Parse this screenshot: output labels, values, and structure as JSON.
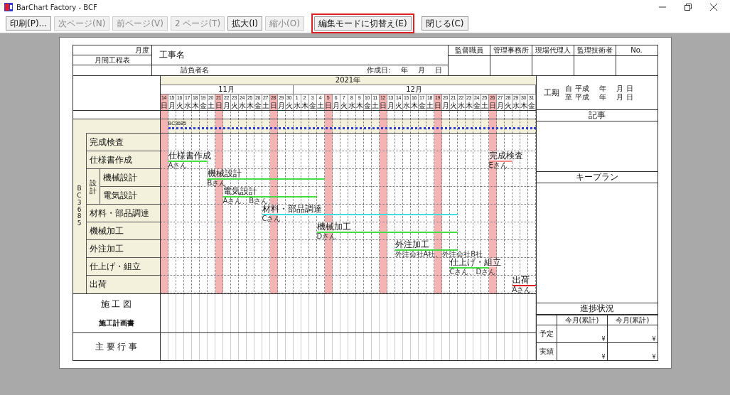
{
  "window": {
    "title": "BarChart Factory - BCF"
  },
  "toolbar": [
    {
      "label": "印刷(P)...",
      "disabled": false,
      "highlighted": false
    },
    {
      "label": "次ページ(N)",
      "disabled": true,
      "highlighted": false
    },
    {
      "label": "前ページ(V)",
      "disabled": true,
      "highlighted": false
    },
    {
      "label": "2 ページ(T)",
      "disabled": true,
      "highlighted": false
    },
    {
      "label": "拡大(I)",
      "disabled": false,
      "highlighted": false
    },
    {
      "label": "縮小(O)",
      "disabled": true,
      "highlighted": false
    },
    {
      "label": "編集モードに切替え(E)",
      "disabled": false,
      "highlighted": true
    },
    {
      "label": "閉じる(C)",
      "disabled": false,
      "highlighted": false
    }
  ],
  "header": {
    "month_label": "月度",
    "sheet_title": "月間工程表",
    "project_name_label": "工事名",
    "contractor_label": "請負者名",
    "created_label": "作成日:",
    "created_year": "年",
    "created_month": "月",
    "created_day": "日",
    "approvals": [
      "監督職員",
      "管理事務所",
      "現場代理人",
      "監理技術者",
      "No."
    ]
  },
  "schedule": {
    "calendar": {
      "year": "2021年",
      "months": [
        {
          "label": "11月",
          "days": [
            {
              "day": "14",
              "weekday": "日",
              "holiday": true
            },
            {
              "day": "15",
              "weekday": "月",
              "holiday": false
            },
            {
              "day": "16",
              "weekday": "火",
              "holiday": false
            },
            {
              "day": "17",
              "weekday": "水",
              "holiday": false
            },
            {
              "day": "18",
              "weekday": "木",
              "holiday": false
            },
            {
              "day": "19",
              "weekday": "金",
              "holiday": false
            },
            {
              "day": "20",
              "weekday": "土",
              "holiday": false
            },
            {
              "day": "21",
              "weekday": "日",
              "holiday": true
            },
            {
              "day": "22",
              "weekday": "月",
              "holiday": false
            },
            {
              "day": "23",
              "weekday": "火",
              "holiday": false
            },
            {
              "day": "24",
              "weekday": "水",
              "holiday": false
            },
            {
              "day": "25",
              "weekday": "木",
              "holiday": false
            },
            {
              "day": "26",
              "weekday": "金",
              "holiday": false
            },
            {
              "day": "27",
              "weekday": "土",
              "holiday": false
            },
            {
              "day": "28",
              "weekday": "日",
              "holiday": true
            },
            {
              "day": "29",
              "weekday": "月",
              "holiday": false
            },
            {
              "day": "30",
              "weekday": "火",
              "holiday": false
            }
          ]
        },
        {
          "label": "12月",
          "days": [
            {
              "day": "1",
              "weekday": "水",
              "holiday": false
            },
            {
              "day": "2",
              "weekday": "木",
              "holiday": false
            },
            {
              "day": "3",
              "weekday": "金",
              "holiday": false
            },
            {
              "day": "4",
              "weekday": "土",
              "holiday": false
            },
            {
              "day": "5",
              "weekday": "日",
              "holiday": true
            },
            {
              "day": "6",
              "weekday": "月",
              "holiday": false
            },
            {
              "day": "7",
              "weekday": "火",
              "holiday": false
            },
            {
              "day": "8",
              "weekday": "水",
              "holiday": false
            },
            {
              "day": "9",
              "weekday": "木",
              "holiday": false
            },
            {
              "day": "10",
              "weekday": "金",
              "holiday": false
            },
            {
              "day": "11",
              "weekday": "土",
              "holiday": false
            },
            {
              "day": "12",
              "weekday": "日",
              "holiday": true
            },
            {
              "day": "13",
              "weekday": "月",
              "holiday": false
            },
            {
              "day": "14",
              "weekday": "火",
              "holiday": false
            },
            {
              "day": "15",
              "weekday": "水",
              "holiday": false
            },
            {
              "day": "16",
              "weekday": "木",
              "holiday": false
            },
            {
              "day": "17",
              "weekday": "金",
              "holiday": false
            },
            {
              "day": "18",
              "weekday": "土",
              "holiday": false
            },
            {
              "day": "19",
              "weekday": "日",
              "holiday": true
            },
            {
              "day": "20",
              "weekday": "月",
              "holiday": false
            },
            {
              "day": "21",
              "weekday": "火",
              "holiday": false
            },
            {
              "day": "22",
              "weekday": "水",
              "holiday": false
            },
            {
              "day": "23",
              "weekday": "木",
              "holiday": false
            },
            {
              "day": "24",
              "weekday": "金",
              "holiday": false
            },
            {
              "day": "25",
              "weekday": "土",
              "holiday": false
            },
            {
              "day": "26",
              "weekday": "日",
              "holiday": true
            },
            {
              "day": "27",
              "weekday": "月",
              "holiday": false
            },
            {
              "day": "28",
              "weekday": "火",
              "holiday": false
            },
            {
              "day": "29",
              "weekday": "水",
              "holiday": false
            },
            {
              "day": "30",
              "weekday": "木",
              "holiday": false
            },
            {
              "day": "31",
              "weekday": "金",
              "holiday": false
            }
          ]
        }
      ]
    },
    "project_code": "BC3685",
    "project": {
      "label": "BC3685",
      "color": "#2b3bd8"
    },
    "tasks": [
      {
        "label": "完成検査"
      },
      {
        "label": "仕様書作成",
        "bars": [
          {
            "label": "仕様書作成",
            "assignee": "Aさん",
            "color": "#44dd44"
          },
          {
            "label": "完成検査",
            "assignee": "Eさん",
            "color": "#f08c8c"
          }
        ]
      },
      {
        "label": "設計",
        "children": [
          {
            "label": "機械設計",
            "bars": [
              {
                "label": "機械設計",
                "assignee": "Bさん",
                "color": "#44dd44"
              }
            ]
          },
          {
            "label": "電気設計",
            "bars": [
              {
                "label": "電気設計",
                "assignee": "Aさん、Bさん",
                "color": "#44dd44"
              }
            ]
          }
        ]
      },
      {
        "label": "材料・部品調達",
        "bars": [
          {
            "label": "材料・部品調達",
            "assignee": "Cさん",
            "color": "#44dddd"
          }
        ]
      },
      {
        "label": "機械加工",
        "bars": [
          {
            "label": "機械加工",
            "assignee": "Dさん",
            "color": "#44dd44"
          }
        ]
      },
      {
        "label": "外注加工",
        "bars": [
          {
            "label": "外注加工",
            "assignee": "外注会社A社、外注会社B社",
            "color": "#44dd44"
          }
        ]
      },
      {
        "label": "仕上げ・組立",
        "bars": [
          {
            "label": "仕上げ・組立",
            "assignee": "Cさん、Dさん",
            "color": "#44dd44"
          }
        ]
      },
      {
        "label": "出荷",
        "bars": [
          {
            "label": "出荷",
            "assignee": "Aさん",
            "color": "#e02020"
          }
        ]
      }
    ]
  },
  "bottom": {
    "drawings_title": "施 工 図",
    "plan_label": "施工計画書",
    "events_title": "主 要 行 事"
  },
  "side": {
    "period_label": "工期",
    "period_rows": [
      {
        "prefix": "自",
        "era": "平成",
        "year": "年",
        "month": "月",
        "day": "日"
      },
      {
        "prefix": "至",
        "era": "平成",
        "year": "年",
        "month": "月",
        "day": "日"
      }
    ],
    "notes_title": "記事",
    "key_plan_title": "キープラン",
    "progress": {
      "title": "進捗状況",
      "columns": [
        "今月(累計)",
        "今月(累計)"
      ],
      "rows": [
        {
          "label": "予定",
          "cells": [
            "¥",
            "¥"
          ]
        },
        {
          "label": "実績",
          "cells": [
            "¥",
            "¥"
          ]
        }
      ]
    }
  }
}
